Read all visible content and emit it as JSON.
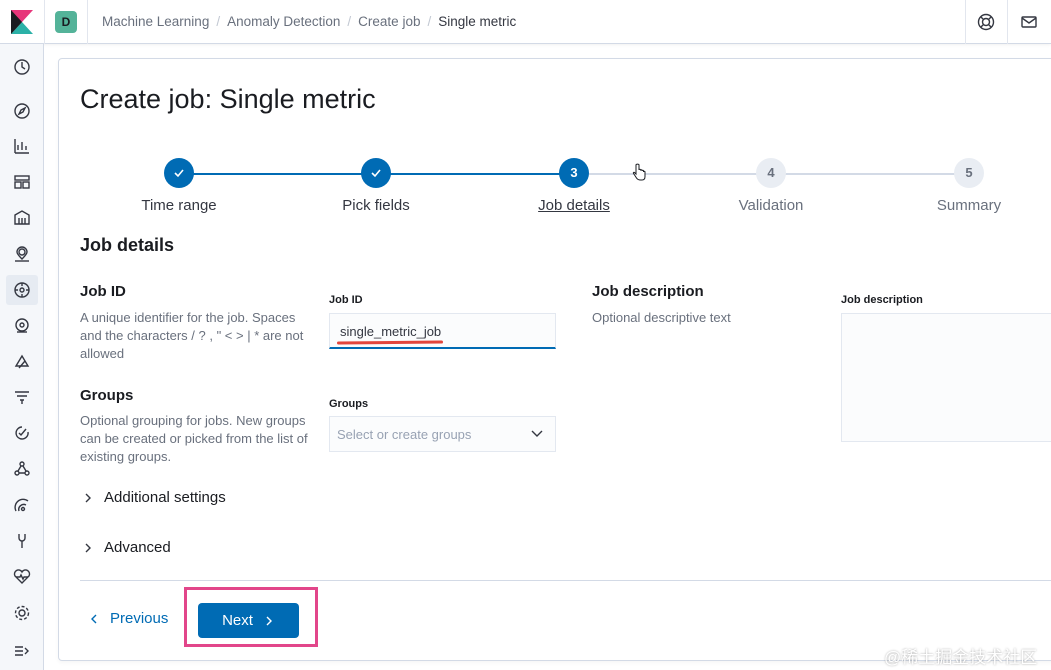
{
  "header": {
    "space_initial": "D",
    "breadcrumbs": [
      "Machine Learning",
      "Anomaly Detection",
      "Create job",
      "Single metric"
    ]
  },
  "page": {
    "title": "Create job: Single metric"
  },
  "steps": [
    {
      "number": "1",
      "label": "Time range",
      "state": "complete"
    },
    {
      "number": "2",
      "label": "Pick fields",
      "state": "complete"
    },
    {
      "number": "3",
      "label": "Job details",
      "state": "current"
    },
    {
      "number": "4",
      "label": "Validation",
      "state": "incomplete"
    },
    {
      "number": "5",
      "label": "Summary",
      "state": "incomplete"
    }
  ],
  "job_details": {
    "section_title": "Job details",
    "job_id": {
      "title": "Job ID",
      "description": "A unique identifier for the job. Spaces and the characters / ? , \" < > | * are not allowed",
      "label": "Job ID",
      "value": "single_metric_job"
    },
    "groups": {
      "title": "Groups",
      "description": "Optional grouping for jobs. New groups can be created or picked from the list of existing groups.",
      "label": "Groups",
      "placeholder": "Select or create groups"
    },
    "job_description": {
      "title": "Job description",
      "description": "Optional descriptive text",
      "label": "Job description",
      "value": ""
    },
    "additional_settings_label": "Additional settings",
    "advanced_label": "Advanced"
  },
  "footer": {
    "previous_label": "Previous",
    "next_label": "Next"
  },
  "watermark": "@稀土掘金技术社区",
  "colors": {
    "primary": "#006bb4",
    "highlight": "#e2468a",
    "underline": "#e2463d",
    "space_badge": "#54b399"
  }
}
